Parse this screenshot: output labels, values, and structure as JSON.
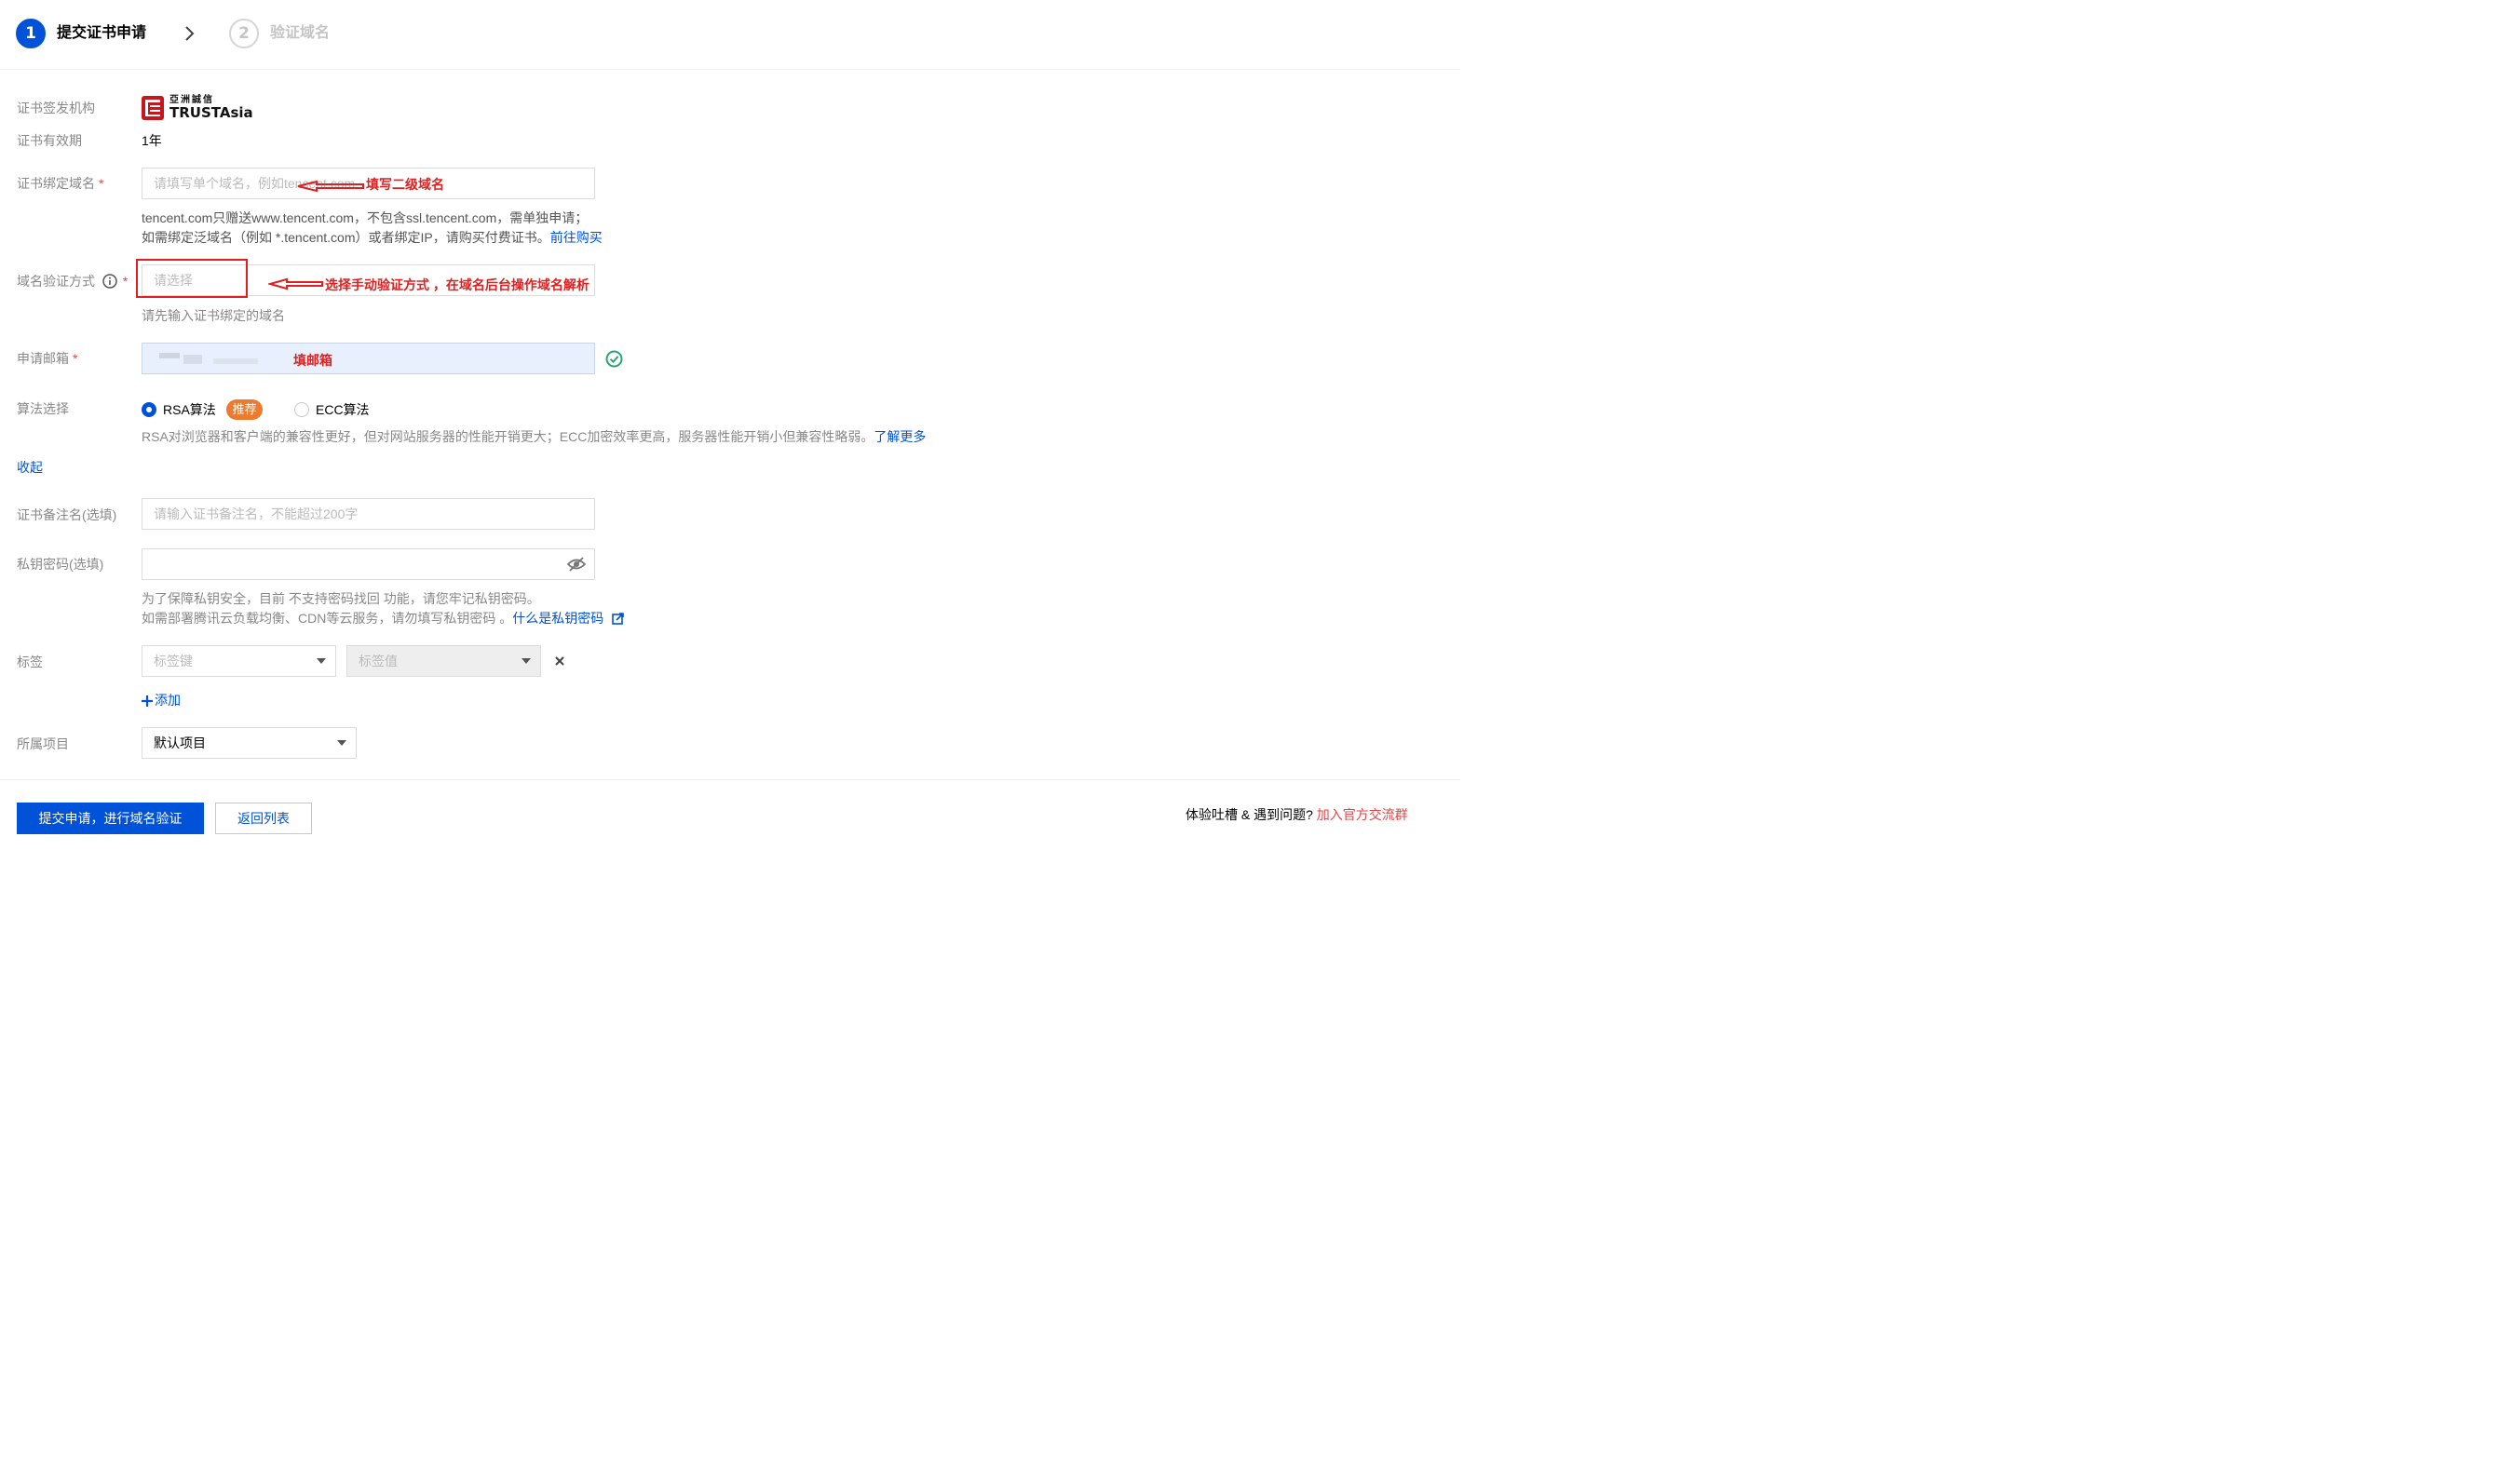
{
  "steps": {
    "step1": {
      "number": "1",
      "label": "提交证书申请"
    },
    "step2": {
      "number": "2",
      "label": "验证域名"
    }
  },
  "form": {
    "issuer": {
      "label": "证书签发机构",
      "logo_text_top": "亞洲誠信",
      "logo_text_main": "TRUSTAsia"
    },
    "validity": {
      "label": "证书有效期",
      "value": "1年"
    },
    "domain": {
      "label": "证书绑定域名",
      "placeholder": "请填写单个域名，例如tencent.com",
      "annotation": "填写二级域名",
      "hint_line1": "tencent.com只赠送www.tencent.com，不包含ssl.tencent.com，需单独申请；",
      "hint_line2": "如需绑定泛域名（例如 *.tencent.com）或者绑定IP，请购买付费证书。",
      "hint_link": "前往购买"
    },
    "verify_method": {
      "label": "域名验证方式",
      "placeholder": "请选择",
      "annotation": "选择手动验证方式 ，在域名后台操作域名解析",
      "hint": "请先输入证书绑定的域名"
    },
    "email": {
      "label": "申请邮箱",
      "annotation": "填邮箱"
    },
    "algorithm": {
      "label": "算法选择",
      "option_rsa": "RSA算法",
      "badge": "推荐",
      "option_ecc": "ECC算法",
      "selected": "RSA算法",
      "hint": "RSA对浏览器和客户端的兼容性更好，但对网站服务器的性能开销更大；ECC加密效率更高，服务器性能开销小但兼容性略弱。",
      "hint_link": "了解更多"
    },
    "collapse_link": "收起",
    "remark": {
      "label": "证书备注名(选填)",
      "placeholder": "请输入证书备注名，不能超过200字"
    },
    "private_key": {
      "label": "私钥密码(选填)",
      "hint_line1": "为了保障私钥安全，目前 不支持密码找回 功能，请您牢记私钥密码。",
      "hint_line2": "如需部署腾讯云负载均衡、CDN等云服务，请勿填写私钥密码 。",
      "hint_link": "什么是私钥密码"
    },
    "tags": {
      "label": "标签",
      "key_placeholder": "标签键",
      "value_placeholder": "标签值",
      "add_label": "添加"
    },
    "project": {
      "label": "所属项目",
      "value": "默认项目"
    }
  },
  "footer": {
    "submit_label": "提交申请，进行域名验证",
    "back_label": "返回列表",
    "feedback_text": "体验吐槽 & 遇到问题?",
    "feedback_link": "加入官方交流群"
  },
  "colors": {
    "primary": "#0052d9",
    "annotation": "#e02020",
    "badge": "#ed7b2f",
    "success": "#2ba471"
  }
}
